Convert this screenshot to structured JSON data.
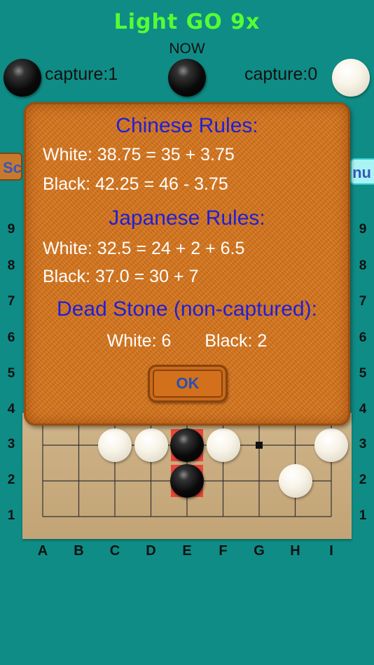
{
  "app": {
    "title": "Light GO 9x",
    "turn_label": "NOW"
  },
  "colors": {
    "background": "#0f8c86",
    "title": "#55ff33",
    "dialog_heading": "#1f1fd8",
    "highlight": "#e8463a"
  },
  "players": {
    "black": {
      "capture_label": "capture:1"
    },
    "white": {
      "capture_label": "capture:0"
    }
  },
  "side_buttons": {
    "left": "Sc",
    "right": "nu"
  },
  "board": {
    "columns": [
      "A",
      "B",
      "C",
      "D",
      "E",
      "F",
      "G",
      "H",
      "I"
    ],
    "rows": [
      "9",
      "8",
      "7",
      "6",
      "5",
      "4",
      "3",
      "2",
      "1"
    ],
    "stones": [
      {
        "color": "white",
        "point": "C3"
      },
      {
        "color": "white",
        "point": "D3"
      },
      {
        "color": "black",
        "point": "E3",
        "highlight": true
      },
      {
        "color": "white",
        "point": "F3"
      },
      {
        "color": "white",
        "point": "I3"
      },
      {
        "color": "black",
        "point": "E2",
        "highlight": true
      },
      {
        "color": "white",
        "point": "H2"
      }
    ],
    "markers": [
      {
        "type": "square",
        "point": "G3"
      }
    ]
  },
  "dialog": {
    "chinese_heading": "Chinese Rules:",
    "chinese_white": "White: 38.75 = 35 + 3.75",
    "chinese_black": "Black: 42.25 = 46 - 3.75",
    "japanese_heading": "Japanese Rules:",
    "japanese_white": "White: 32.5 = 24 + 2 + 6.5",
    "japanese_black": "Black: 37.0 = 30 + 7",
    "dead_heading": "Dead Stone (non-captured):",
    "dead_white": "White: 6",
    "dead_black": "Black: 2",
    "ok_label": "OK"
  }
}
